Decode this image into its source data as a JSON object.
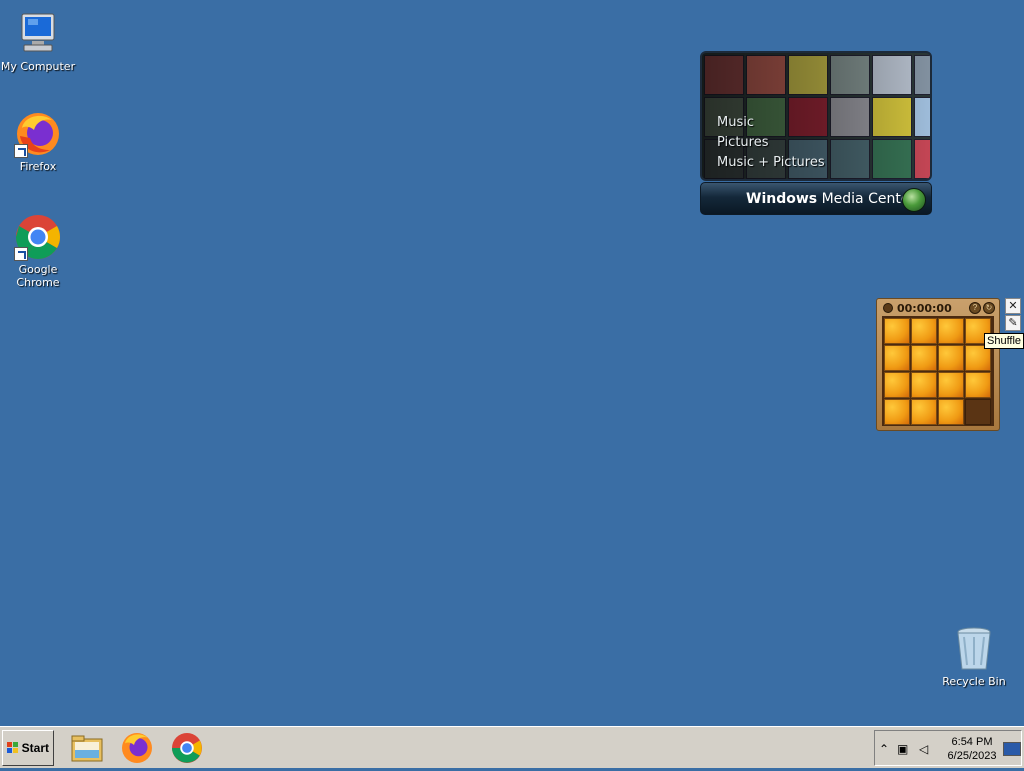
{
  "desktop": {
    "icons": [
      {
        "label": "My Computer",
        "icon": "computer-icon"
      },
      {
        "label": "Firefox",
        "icon": "firefox-icon"
      },
      {
        "label": "Google Chrome",
        "icon": "chrome-icon"
      },
      {
        "label": "Recycle Bin",
        "icon": "recycle-bin-icon"
      }
    ],
    "background_color": "#3a6ea5"
  },
  "media_center": {
    "menu": [
      "Music",
      "Pictures",
      "Music + Pictures"
    ],
    "brand_bold": "Windows",
    "brand_rest": " Media Center"
  },
  "puzzle_gadget": {
    "timer": "00:00:00",
    "tooltip": "Shuffle",
    "buttons": [
      "help-icon",
      "shuffle-icon",
      "close-icon",
      "settings-icon"
    ]
  },
  "taskbar": {
    "start_label": "Start",
    "apps": [
      "file-explorer-icon",
      "firefox-icon",
      "chrome-icon"
    ],
    "tray": {
      "time": "6:54 PM",
      "date": "6/25/2023",
      "icons": [
        "show-hidden-icon",
        "network-icon",
        "volume-muted-icon",
        "show-desktop-icon"
      ]
    }
  }
}
